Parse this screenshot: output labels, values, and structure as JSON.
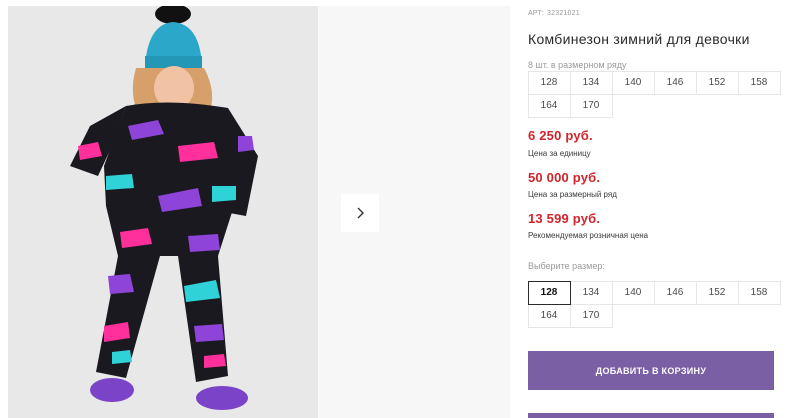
{
  "gallery": {
    "next_icon": "chevron-right-icon",
    "colors": {
      "suit_base": "#1b1920",
      "purple": "#8e44d8",
      "pink": "#ff2f9b",
      "cyan": "#2fd2d6",
      "hat": "#2ba7c9"
    }
  },
  "product": {
    "article_label": "АРТ:",
    "article_value": "32321021",
    "title": "Комбинезон зимний для девочки",
    "pack_note": "8 шт. в размерном ряду",
    "sizes": [
      "128",
      "134",
      "140",
      "146",
      "152",
      "158",
      "164",
      "170"
    ]
  },
  "prices": {
    "unit_price": "6 250 руб.",
    "unit_label": "Цена за единицу",
    "row_price": "50 000 руб.",
    "row_label": "Цена за размерный ряд",
    "retail_price": "13 599 руб.",
    "retail_label": "Рекомендуемая розничная цена"
  },
  "size_picker": {
    "label": "Выберите размер:",
    "selected": "128",
    "sizes": [
      "128",
      "134",
      "140",
      "146",
      "152",
      "158",
      "164",
      "170"
    ]
  },
  "actions": {
    "add_to_cart": "ДОБАВИТЬ В КОРЗИНУ",
    "accent_color": "#7a5fa5"
  },
  "colors": {
    "price_red": "#d2232a"
  }
}
